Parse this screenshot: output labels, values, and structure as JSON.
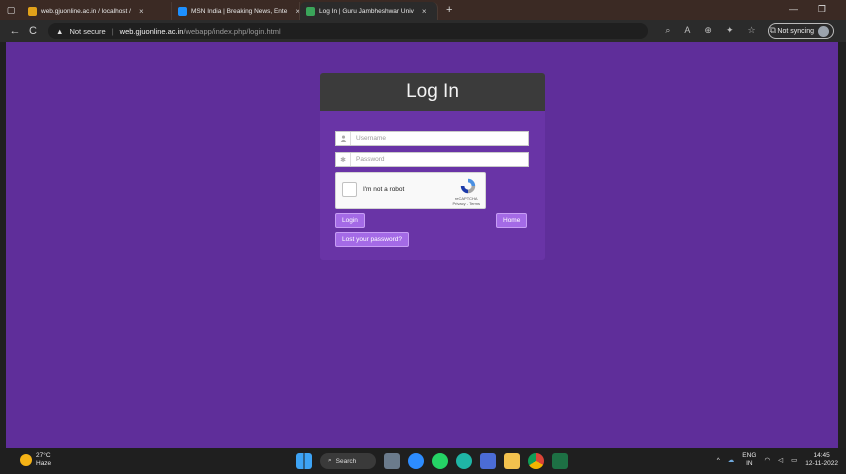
{
  "browser": {
    "tabs": [
      {
        "title": "web.gjuonline.ac.in / localhost /",
        "color": "#e3a21a"
      },
      {
        "title": "MSN India | Breaking News, Ente",
        "color": "#1e90ff"
      },
      {
        "title": "Log In | Guru Jambheshwar Univ",
        "color": "#3aa55a"
      }
    ],
    "new_tab": "+",
    "minimize": "—",
    "restore": "❐",
    "back": "←",
    "refresh": "C",
    "security_label": "Not secure",
    "url_host": "web.gjuonline.ac.in",
    "url_path": "/webapp/index.php/login.html",
    "sync_label": "Not syncing"
  },
  "login": {
    "title": "Log In",
    "username_placeholder": "Username",
    "password_placeholder": "Password",
    "captcha_label": "I'm not a robot",
    "captcha_brand": "reCAPTCHA",
    "captcha_links": "Privacy - Terms",
    "login_button": "Login",
    "home_button": "Home",
    "lost_password_button": "Lost your password?"
  },
  "taskbar": {
    "temperature": "27°C",
    "weather": "Haze",
    "search_label": "Search",
    "lang_top": "ENG",
    "lang_bottom": "IN",
    "time": "14:45",
    "date": "12-11-2022"
  },
  "colors": {
    "page_bg": "#5f2e9a",
    "card_bg": "#6934a6",
    "header_bg": "#3b3b3b",
    "button_bg": "#a46ae6"
  }
}
